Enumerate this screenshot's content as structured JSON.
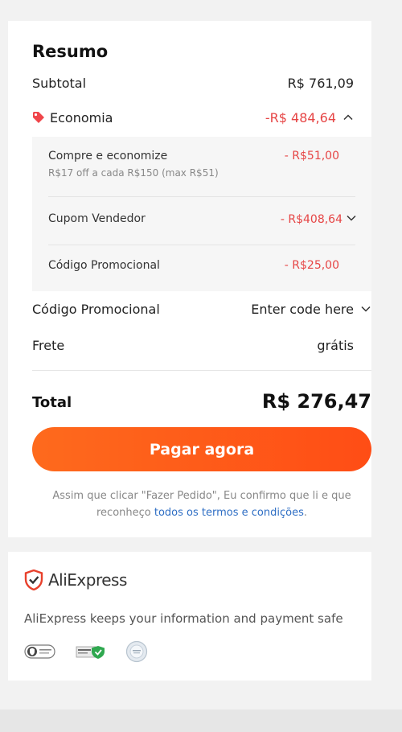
{
  "summary": {
    "title": "Resumo",
    "subtotal_label": "Subtotal",
    "subtotal_value": "R$ 761,09",
    "savings_label": "Economia",
    "savings_value": "-R$ 484,64",
    "savings_details": [
      {
        "label": "Compre e economize",
        "sub": "R$17 off a cada R$150 (max R$51)",
        "value": "- R$51,00"
      },
      {
        "label": "Cupom Vendedor",
        "value": "- R$408,64"
      },
      {
        "label": "Código Promocional",
        "value": "- R$25,00"
      }
    ],
    "promo_label": "Código Promocional",
    "promo_value": "Enter code here",
    "shipping_label": "Frete",
    "shipping_value": "grátis",
    "total_label": "Total",
    "total_value": "R$ 276,47",
    "pay_button": "Pagar agora",
    "disclaimer_text": "Assim que clicar \"Fazer Pedido\", Eu confirmo que li e que reconheço ",
    "disclaimer_link": "todos os termos e condições",
    "disclaimer_end": "."
  },
  "trust": {
    "brand": "AliExpress",
    "safe_text": "AliExpress keeps your information and payment safe",
    "badges": [
      "privacy-badge-icon",
      "pci-badge-icon",
      "seal-badge-icon"
    ]
  },
  "colors": {
    "accent": "#ff4d15",
    "discount": "#e64545",
    "link": "#2e6ec4"
  }
}
